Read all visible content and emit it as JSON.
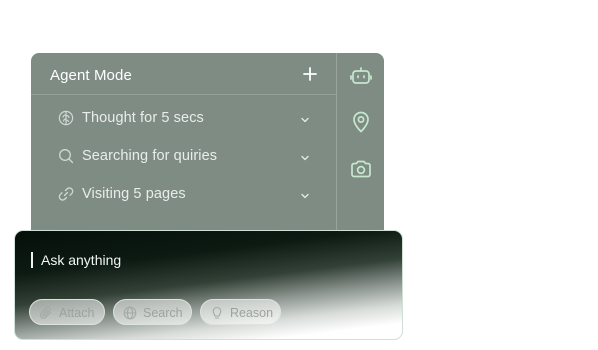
{
  "agent": {
    "title": "Agent Mode",
    "new_icon": "plus-icon",
    "steps": [
      {
        "icon": "brain-icon",
        "label": "Thought for 5 secs"
      },
      {
        "icon": "search-icon",
        "label": "Searching for quiries"
      },
      {
        "icon": "link-icon",
        "label": "Visiting 5 pages"
      }
    ],
    "rail_icons": [
      "robot-icon",
      "location-pin-icon",
      "camera-icon"
    ]
  },
  "composer": {
    "placeholder": "Ask anything",
    "chips": [
      {
        "icon": "paperclip-icon",
        "label": "Attach"
      },
      {
        "icon": "globe-icon",
        "label": "Search"
      },
      {
        "icon": "lightbulb-icon",
        "label": "Reason"
      }
    ]
  },
  "colors": {
    "panel": "#7f8c84",
    "rail_icon": "#c6e8cf",
    "composer_top": "#050f09"
  }
}
